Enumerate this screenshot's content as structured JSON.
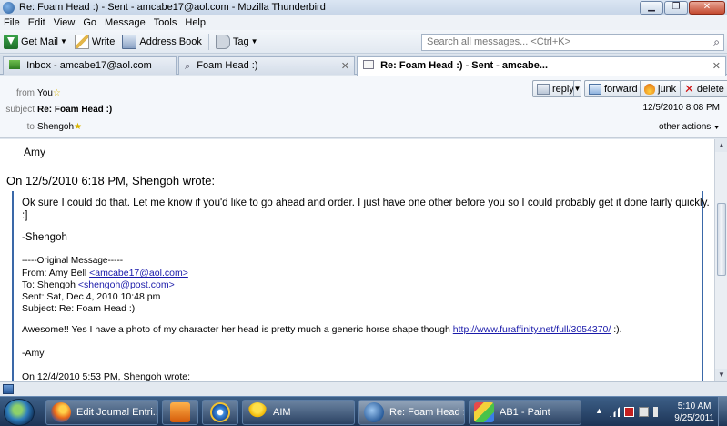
{
  "window": {
    "title": "Re: Foam Head :) - Sent - amcabe17@aol.com - Mozilla Thunderbird"
  },
  "menu": [
    "File",
    "Edit",
    "View",
    "Go",
    "Message",
    "Tools",
    "Help"
  ],
  "toolbar": {
    "get_mail": "Get Mail",
    "write": "Write",
    "address_book": "Address Book",
    "tag": "Tag",
    "search_placeholder": "Search all messages... <Ctrl+K>"
  },
  "tabs": [
    {
      "label": "Inbox - amcabe17@aol.com"
    },
    {
      "label": "Foam Head :)"
    },
    {
      "label": "Re: Foam Head :) - Sent - amcabe..."
    }
  ],
  "header": {
    "from_label": "from",
    "from_value": "You",
    "subject_label": "subject",
    "subject_value": "Re: Foam Head :)",
    "to_label": "to",
    "to_value": "Shengoh",
    "date": "12/5/2010 8:08 PM",
    "other_actions": "other actions",
    "buttons": {
      "reply": "reply",
      "forward": "forward",
      "junk": "junk",
      "delete": "delete"
    }
  },
  "message": {
    "signature": "Amy",
    "wrote_line": "On 12/5/2010 6:18 PM, Shengoh wrote:",
    "quote": {
      "para1_line1": "Ok sure I could do that. Let me know if you'd like to go ahead and order. I just have one other before you so I could probably get it done fairly quickly.",
      "para1_line2": ":]",
      "sign": "-Shengoh",
      "original_header": "-----Original Message-----",
      "from_prefix": "From: Amy Bell ",
      "from_email": "<amcabe17@aol.com>",
      "to_prefix": "To: Shengoh ",
      "to_email": "<shengoh@post.com>",
      "sent": "Sent: Sat, Dec 4, 2010 10:48 pm",
      "subject": "Subject: Re: Foam Head :)",
      "body_prefix": "Awesome!! Yes I have a photo of my character her head is pretty much a generic horse shape though ",
      "body_link": "http://www.furaffinity.net/full/3054370/",
      "body_suffix": " :).",
      "body_sign": "-Amy",
      "next_wrote": "On 12/4/2010 5:53 PM, Shengoh wrote:"
    }
  },
  "taskbar": {
    "tasks": [
      {
        "label": "Edit Journal Entri..."
      },
      {
        "label": ""
      },
      {
        "label": ""
      },
      {
        "label": "AIM"
      },
      {
        "label": "Re: Foam Head :)..."
      },
      {
        "label": "AB1 - Paint"
      }
    ],
    "time": "5:10 AM",
    "date": "9/25/2011"
  },
  "colors": {
    "link": "#1a1aaa",
    "quote_bar": "#3a68a8",
    "taskbar": "#1d3456"
  }
}
